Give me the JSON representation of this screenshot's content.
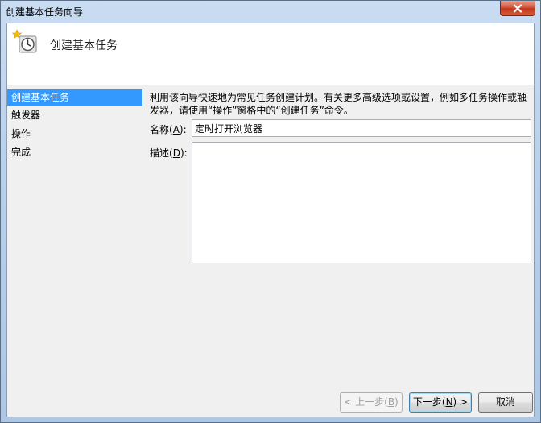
{
  "window": {
    "title": "创建基本任务向导",
    "close_icon": "close-icon"
  },
  "header": {
    "icon": "scheduled-task-clock-icon",
    "title": "创建基本任务"
  },
  "nav": {
    "items": [
      {
        "label": "创建基本任务",
        "active": true
      },
      {
        "label": "触发器",
        "active": false
      },
      {
        "label": "操作",
        "active": false
      },
      {
        "label": "完成",
        "active": false
      }
    ]
  },
  "main": {
    "description": "利用该向导快速地为常见任务创建计划。有关更多高级选项或设置，例如多任务操作或触发器，请使用“操作”窗格中的“创建任务”命令。",
    "name_label": {
      "text": "名称(",
      "key": "A",
      "suffix": "):"
    },
    "name_value": "定时打开浏览器",
    "desc_label": {
      "text": "描述(",
      "key": "D",
      "suffix": "):"
    },
    "desc_value": ""
  },
  "buttons": {
    "back": {
      "pre": "< 上一步(",
      "key": "B",
      "post": ")"
    },
    "next": {
      "pre": "下一步(",
      "key": "N",
      "post": ") >"
    },
    "cancel": {
      "label": "取消"
    }
  },
  "colors": {
    "selection": "#3399ff",
    "window_frame": "#b9d0ea",
    "close_button": "#c3361c"
  }
}
